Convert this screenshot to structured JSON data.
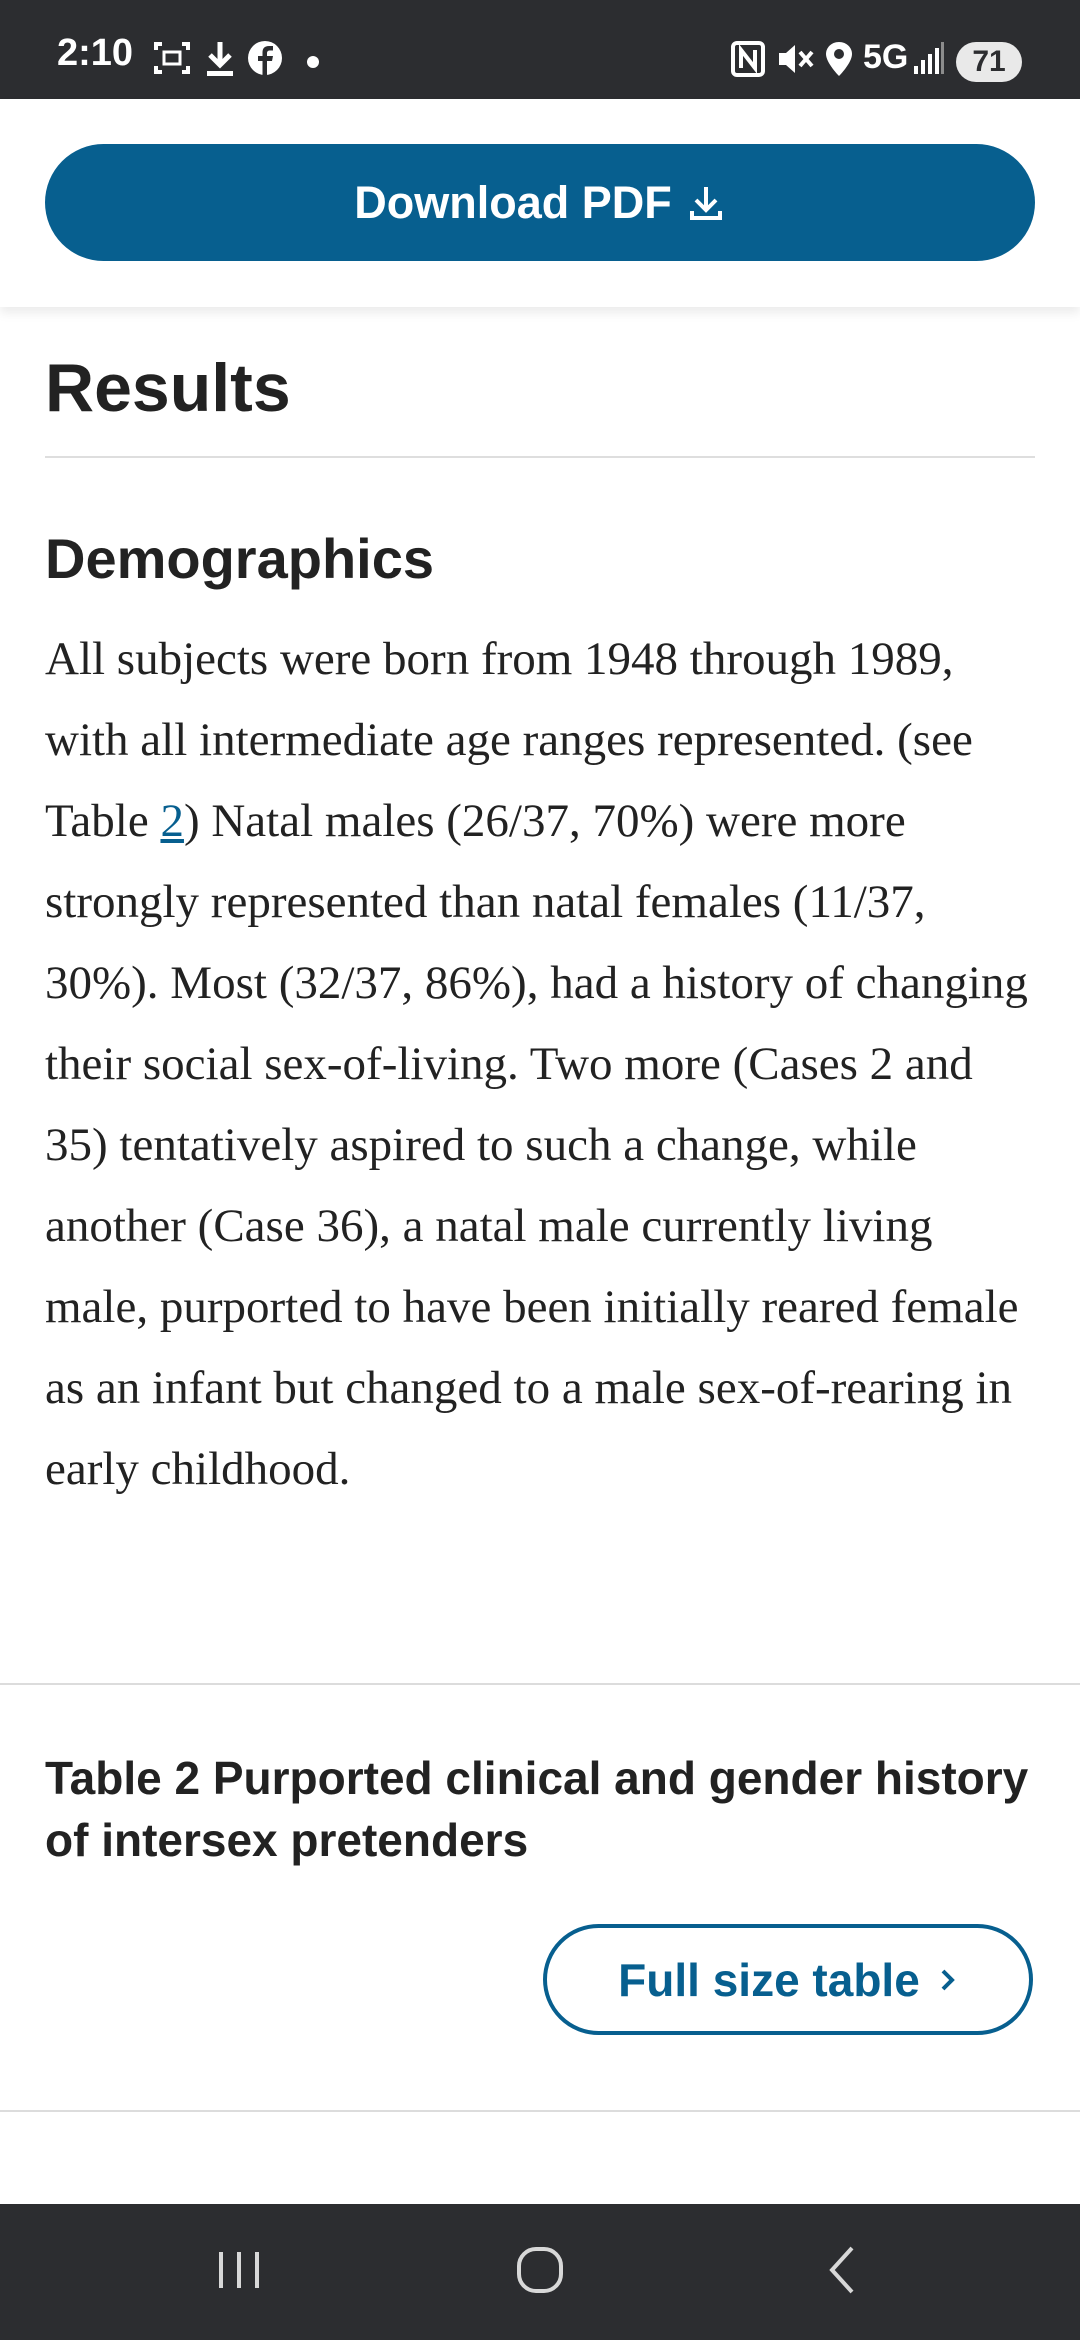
{
  "status_bar": {
    "time": "2:10",
    "network": "5G",
    "battery": "71",
    "icons": [
      "screenshot-icon",
      "download-icon",
      "facebook-icon",
      "dot-icon",
      "nfc-icon",
      "mute-icon",
      "location-icon",
      "signal-icon"
    ]
  },
  "toolbar": {
    "download_label": "Download PDF",
    "download_icon": "download-icon"
  },
  "article": {
    "section_title": "Results",
    "subsection_title": "Demographics",
    "paragraph": {
      "before_link": "All subjects were born from 1948 through 1989, with all intermediate age ranges represented. (see Table ",
      "link_text": "2",
      "after_link": ") Natal males (26/37, 70%) were more strongly represented than natal females (11/37, 30%). Most (32/37, 86%), had a history of changing their social sex-of-living. Two more (Cases 2 and 35) tentatively aspired to such a change, while another (Case 36), a natal male currently living male, purported to have been initially reared female as an infant but changed to a male sex-of-rearing in early childhood."
    },
    "table_caption": "Table 2 Purported clinical and gender history of intersex pretenders",
    "full_size_label": "Full size table"
  },
  "navigation": {
    "items": [
      "recent-apps-icon",
      "home-icon",
      "back-icon"
    ]
  },
  "colors": {
    "accent": "#075f8f",
    "system_bar": "#2c2d30",
    "text": "#222222"
  }
}
